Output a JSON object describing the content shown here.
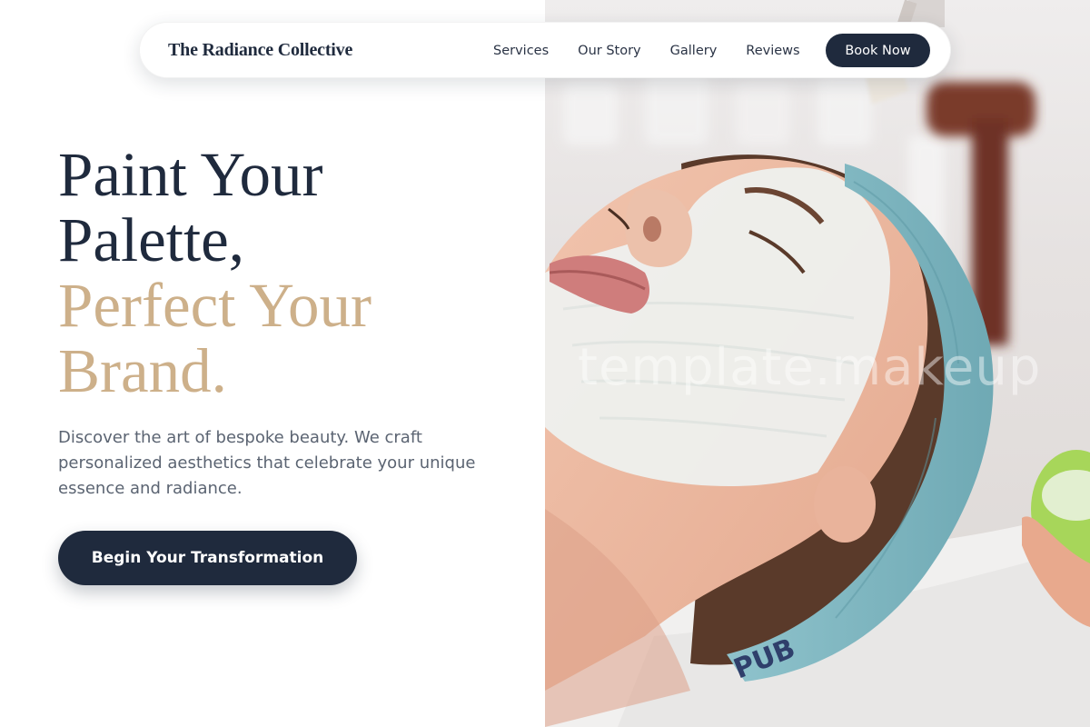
{
  "brand": {
    "name": "The Radiance Collective"
  },
  "nav": {
    "links": [
      "Services",
      "Our Story",
      "Gallery",
      "Reviews"
    ],
    "cta_label": "Book Now"
  },
  "hero": {
    "headline_lines": [
      "Paint Your",
      "Palette,",
      "Perfect Your",
      "Brand."
    ],
    "subtext": "Discover the art of bespoke beauty. We craft personalized aesthetics that celebrate your unique essence and radiance.",
    "cta_label": "Begin Your Transformation",
    "image_watermark": "template.makeup",
    "image_subject": "woman-receiving-facial-mask-treatment"
  },
  "colors": {
    "navy": "#1f2a3d",
    "gold": "#cdb08a",
    "body_text": "#5b6472"
  }
}
